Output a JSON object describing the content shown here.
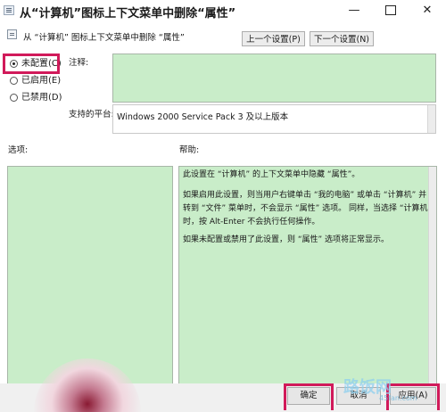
{
  "window": {
    "title": "从“计算机”图标上下文菜单中删除“属性”",
    "controls": {
      "minimize": "—",
      "close": "✕"
    }
  },
  "policy": {
    "name": "从 “计算机” 图标上下文菜单中删除 “属性”",
    "prev_label": "上一个设置(P)",
    "next_label": "下一个设置(N)"
  },
  "state": {
    "options": [
      {
        "label": "未配置(C)",
        "selected": true
      },
      {
        "label": "已启用(E)",
        "selected": false
      },
      {
        "label": "已禁用(D)",
        "selected": false
      }
    ]
  },
  "fields": {
    "comment_label": "注释:",
    "comment_value": "",
    "platform_label": "支持的平台:",
    "platform_value": "Windows 2000 Service Pack 3 及以上版本"
  },
  "panels": {
    "options_label": "选项:",
    "help_label": "帮助:",
    "help_text": [
      "此设置在 “计算机” 的上下文菜单中隐藏 “属性”。",
      "如果启用此设置，则当用户右键单击 “我的电脑” 或单击 “计算机” 并转到 “文件” 菜单时，不会显示 “属性” 选项。 同样，当选择 “计算机” 时，按 Alt-Enter 不会执行任何操作。",
      "如果未配置或禁用了此设置，则 “属性” 选项将正常显示。"
    ]
  },
  "buttons": {
    "ok": "确定",
    "cancel": "取消",
    "apply": "应用(A)"
  },
  "watermark": {
    "text": "路饭网",
    "sub": "45fan.com"
  },
  "colors": {
    "highlight": "#d11a5a",
    "panel_bg": "#c9edc9"
  }
}
